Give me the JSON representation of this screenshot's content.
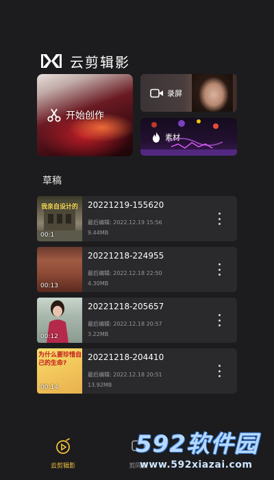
{
  "app": {
    "title": "云剪辑影"
  },
  "cards": {
    "create": {
      "label": "开始创作"
    },
    "record": {
      "label": "录屏"
    },
    "material": {
      "label": "素材"
    }
  },
  "drafts": {
    "section_title": "草稿",
    "items": [
      {
        "name": "20221219-155620",
        "edited": "最后编辑: 2022.12.19 15:56",
        "size": "9.44MB",
        "duration": "00:1",
        "thumb_text": "我亲自设计的"
      },
      {
        "name": "20221218-224955",
        "edited": "最后编辑: 2022.12.18 22:50",
        "size": "4.30MB",
        "duration": "00:13"
      },
      {
        "name": "20221218-205657",
        "edited": "最后编辑: 2022.12.18 20:57",
        "size": "3.22MB",
        "duration": "00:12"
      },
      {
        "name": "20221218-204410",
        "edited": "最后编辑: 2022.12.18 20:51",
        "size": "13.92MB",
        "duration": "00:14",
        "thumb_text": "为什么要珍惜自己的生命?"
      }
    ]
  },
  "nav": {
    "home_label": "云剪辑影",
    "cut_label": "剪同款"
  },
  "watermark": {
    "main": "592软件园",
    "url": "www.592xiazai.com"
  },
  "colors": {
    "accent": "#f4c23b",
    "background": "#1c1c1e",
    "card": "#2a2a2c"
  },
  "icons": [
    "app-logo-icon",
    "scissors-icon",
    "video-camera-icon",
    "flame-icon",
    "more-vertical-icon",
    "home-icon",
    "cut-template-icon"
  ]
}
